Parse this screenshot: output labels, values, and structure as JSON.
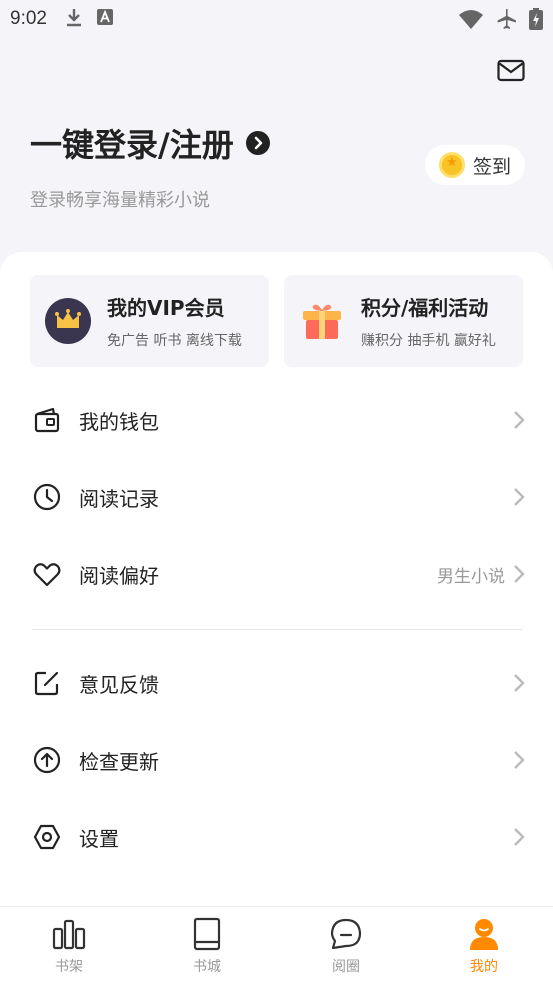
{
  "status_bar": {
    "time": "9:02"
  },
  "header": {
    "login_title": "一键登录/注册",
    "login_subtitle": "登录畅享海量精彩小说",
    "signin_label": "签到"
  },
  "promos": {
    "vip": {
      "title": "我的VIP会员",
      "desc": "免广告 听书 离线下载"
    },
    "points": {
      "title": "积分/福利活动",
      "desc": "赚积分 抽手机 赢好礼"
    }
  },
  "menu": [
    {
      "label": "我的钱包",
      "value": ""
    },
    {
      "label": "阅读记录",
      "value": ""
    },
    {
      "label": "阅读偏好",
      "value": "男生小说"
    },
    {
      "label": "意见反馈",
      "value": ""
    },
    {
      "label": "检查更新",
      "value": ""
    },
    {
      "label": "设置",
      "value": ""
    }
  ],
  "tabs": [
    {
      "label": "书架",
      "active": false
    },
    {
      "label": "书城",
      "active": false
    },
    {
      "label": "阅圈",
      "active": false
    },
    {
      "label": "我的",
      "active": true
    }
  ],
  "colors": {
    "accent": "#ff8a00",
    "background": "#f5f5f9",
    "vip_badge": "#3a3650",
    "gift": "#ff6b5a"
  },
  "icons": {
    "status": [
      "download-icon",
      "font-icon",
      "wifi-icon",
      "airplane-icon",
      "battery-icon"
    ],
    "menu": [
      "wallet-icon",
      "clock-icon",
      "heart-icon",
      "edit-icon",
      "upload-icon",
      "hexagon-settings-icon"
    ],
    "tabs": [
      "bookshelf-icon",
      "book-icon",
      "chat-icon",
      "person-icon"
    ]
  }
}
